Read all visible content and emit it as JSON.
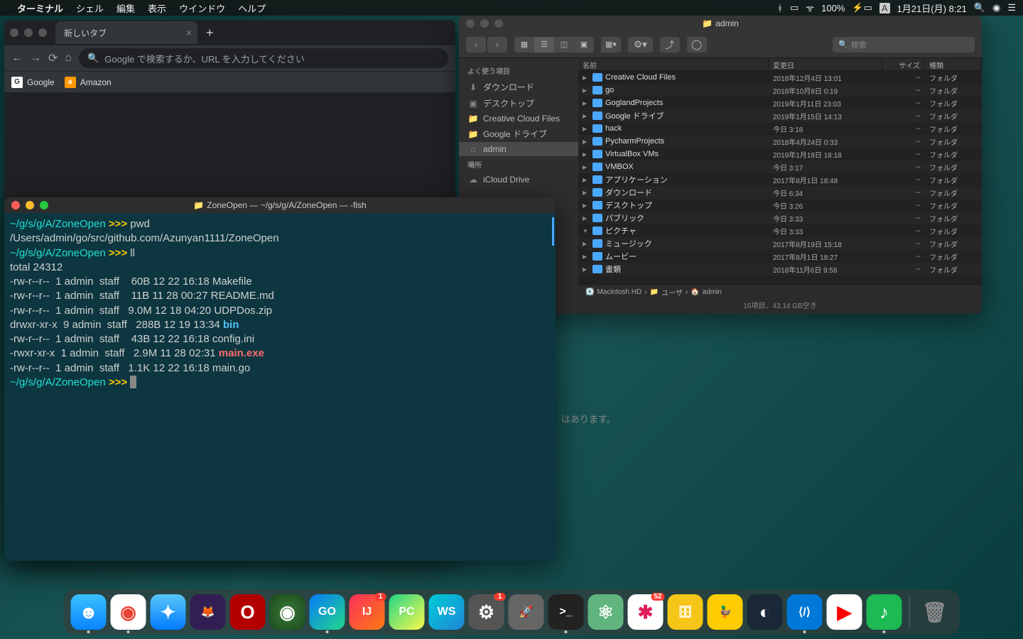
{
  "menubar": {
    "app": "ターミナル",
    "items": [
      "シェル",
      "編集",
      "表示",
      "ウインドウ",
      "ヘルプ"
    ],
    "battery": "100%",
    "input_indicator": "A",
    "date": "1月21日(月) 8:21"
  },
  "chrome": {
    "tab_title": "新しいタブ",
    "omnibox_placeholder": "Google で検索するか、URL を入力してください",
    "bookmarks": [
      {
        "label": "Google",
        "fav": "G"
      },
      {
        "label": "Amazon",
        "fav": "a"
      }
    ]
  },
  "finder": {
    "title": "admin",
    "search_placeholder": "検索",
    "sidebar": {
      "favorites_label": "よく使う項目",
      "favorites": [
        {
          "icon": "⬇",
          "label": "ダウンロード"
        },
        {
          "icon": "▣",
          "label": "デスクトップ"
        },
        {
          "icon": "📁",
          "label": "Creative Cloud Files"
        },
        {
          "icon": "📁",
          "label": "Google ドライブ"
        },
        {
          "icon": "⌂",
          "label": "admin",
          "selected": true
        }
      ],
      "locations_label": "場所",
      "locations": [
        {
          "icon": "☁",
          "label": "iCloud Drive"
        }
      ]
    },
    "columns": {
      "name": "名前",
      "date": "変更日",
      "size": "サイズ",
      "kind": "種類"
    },
    "rows": [
      {
        "name": "Creative Cloud Files",
        "date": "2018年12月4日 13:01",
        "size": "--",
        "kind": "フォルダ",
        "color": "#4aa8ff"
      },
      {
        "name": "go",
        "date": "2018年10月8日 0:19",
        "size": "--",
        "kind": "フォルダ",
        "color": "#4aa8ff"
      },
      {
        "name": "GoglandProjects",
        "date": "2019年1月11日 23:03",
        "size": "--",
        "kind": "フォルダ",
        "color": "#4aa8ff"
      },
      {
        "name": "Google ドライブ",
        "date": "2019年1月15日 14:13",
        "size": "--",
        "kind": "フォルダ",
        "color": "#4aa8ff"
      },
      {
        "name": "hack",
        "date": "今日 3:18",
        "size": "--",
        "kind": "フォルダ",
        "color": "#4aa8ff"
      },
      {
        "name": "PycharmProjects",
        "date": "2018年4月24日 0:33",
        "size": "--",
        "kind": "フォルダ",
        "color": "#4aa8ff"
      },
      {
        "name": "VirtualBox VMs",
        "date": "2019年1月18日 18:18",
        "size": "--",
        "kind": "フォルダ",
        "color": "#4aa8ff"
      },
      {
        "name": "VMBOX",
        "date": "今日 3:17",
        "size": "--",
        "kind": "フォルダ",
        "color": "#4aa8ff"
      },
      {
        "name": "アプリケーション",
        "date": "2017年8月1日 18:48",
        "size": "--",
        "kind": "フォルダ",
        "color": "#4aa8ff"
      },
      {
        "name": "ダウンロード",
        "date": "今日 6:34",
        "size": "--",
        "kind": "フォルダ",
        "color": "#4aa8ff"
      },
      {
        "name": "デスクトップ",
        "date": "今日 3:26",
        "size": "--",
        "kind": "フォルダ",
        "color": "#4aa8ff"
      },
      {
        "name": "パブリック",
        "date": "今日 3:33",
        "size": "--",
        "kind": "フォルダ",
        "color": "#4aa8ff"
      },
      {
        "name": "ピクチャ",
        "date": "今日 3:33",
        "size": "--",
        "kind": "フォルダ",
        "color": "#4aa8ff",
        "expanded": true
      },
      {
        "name": "ミュージック",
        "date": "2017年8月19日 15:18",
        "size": "--",
        "kind": "フォルダ",
        "color": "#4aa8ff"
      },
      {
        "name": "ムービー",
        "date": "2017年8月1日 18:27",
        "size": "--",
        "kind": "フォルダ",
        "color": "#4aa8ff"
      },
      {
        "name": "書類",
        "date": "2018年11月6日 9:58",
        "size": "--",
        "kind": "フォルダ",
        "color": "#4aa8ff"
      }
    ],
    "path": [
      "Macintosh HD",
      "ユーザ",
      "admin"
    ],
    "status": "16項目、43.14 GB空き"
  },
  "body_text": "はあります。",
  "terminal": {
    "title": "ZoneOpen — ~/g/s/g/A/ZoneOpen — -fish",
    "prompt_path": "~/g/s/g/A/ZoneOpen",
    "prompt_arrows": ">>>",
    "cmd_pwd": "pwd",
    "pwd_output": "/Users/admin/go/src/github.com/Azunyan1111/ZoneOpen",
    "cmd_ll": "ll",
    "ll_total": "total 24312",
    "files": [
      {
        "perm": "-rw-r--r--",
        "n": "1",
        "user": "admin",
        "group": "staff",
        "size": "60B",
        "date": "12 22 16:18",
        "name": "Makefile",
        "cls": ""
      },
      {
        "perm": "-rw-r--r--",
        "n": "1",
        "user": "admin",
        "group": "staff",
        "size": "11B",
        "date": "11 28 00:27",
        "name": "README.md",
        "cls": ""
      },
      {
        "perm": "-rw-r--r--",
        "n": "1",
        "user": "admin",
        "group": "staff",
        "size": "9.0M",
        "date": "12 18 04:20",
        "name": "UDPDos.zip",
        "cls": ""
      },
      {
        "perm": "drwxr-xr-x",
        "n": "9",
        "user": "admin",
        "group": "staff",
        "size": "288B",
        "date": "12 19 13:34",
        "name": "bin",
        "cls": "file-dir"
      },
      {
        "perm": "-rw-r--r--",
        "n": "1",
        "user": "admin",
        "group": "staff",
        "size": "43B",
        "date": "12 22 16:18",
        "name": "config.ini",
        "cls": ""
      },
      {
        "perm": "-rwxr-xr-x",
        "n": "1",
        "user": "admin",
        "group": "staff",
        "size": "2.9M",
        "date": "11 28 02:31",
        "name": "main.exe",
        "cls": "file-exe"
      },
      {
        "perm": "-rw-r--r--",
        "n": "1",
        "user": "admin",
        "group": "staff",
        "size": "1.1K",
        "date": "12 22 16:18",
        "name": "main.go",
        "cls": ""
      }
    ]
  },
  "dock": {
    "items": [
      {
        "name": "finder",
        "bg": "linear-gradient(#3ac1ff,#0a84ff)",
        "text": "☻",
        "running": true
      },
      {
        "name": "chrome",
        "bg": "#fff",
        "text": "◉",
        "color": "#ea4335",
        "running": true
      },
      {
        "name": "safari",
        "bg": "linear-gradient(#5ac8fa,#007aff)",
        "text": "✦"
      },
      {
        "name": "firefox",
        "bg": "#331e54",
        "text": "🦊"
      },
      {
        "name": "opera",
        "bg": "#b20000",
        "text": "O"
      },
      {
        "name": "app-green",
        "bg": "radial-gradient(#3a7a3a,#1a4a1a)",
        "text": "◉"
      },
      {
        "name": "goland",
        "bg": "linear-gradient(135deg,#087cfa,#21d789)",
        "text": "GO",
        "running": true
      },
      {
        "name": "intellij",
        "bg": "linear-gradient(135deg,#fe315d,#f97a12)",
        "text": "IJ",
        "badge": "1"
      },
      {
        "name": "pycharm",
        "bg": "linear-gradient(135deg,#21d789,#fcf84a)",
        "text": "PC"
      },
      {
        "name": "webstorm",
        "bg": "linear-gradient(135deg,#00cdd7,#2086d7)",
        "text": "WS"
      },
      {
        "name": "settings",
        "bg": "#555",
        "text": "⚙",
        "badge": "1"
      },
      {
        "name": "launchpad",
        "bg": "#666",
        "text": "🚀"
      },
      {
        "name": "terminal",
        "bg": "#222",
        "text": ">_",
        "running": true
      },
      {
        "name": "atom",
        "bg": "#5fb57d",
        "text": "⚛"
      },
      {
        "name": "slack",
        "bg": "#fff",
        "text": "✱",
        "color": "#e01e5a",
        "badge": "52"
      },
      {
        "name": "db",
        "bg": "#f5c518",
        "text": "🗄"
      },
      {
        "name": "duck",
        "bg": "#ffcc00",
        "text": "🦆"
      },
      {
        "name": "steam",
        "bg": "#1b2838",
        "text": "◐"
      },
      {
        "name": "vscode",
        "bg": "#0078d7",
        "text": "⟨/⟩",
        "running": true
      },
      {
        "name": "youtube",
        "bg": "#fff",
        "text": "▶",
        "color": "#ff0000"
      },
      {
        "name": "spotify",
        "bg": "#1db954",
        "text": "♪",
        "running": true
      }
    ],
    "trash": {
      "name": "trash",
      "bg": "transparent",
      "text": "🗑"
    }
  }
}
